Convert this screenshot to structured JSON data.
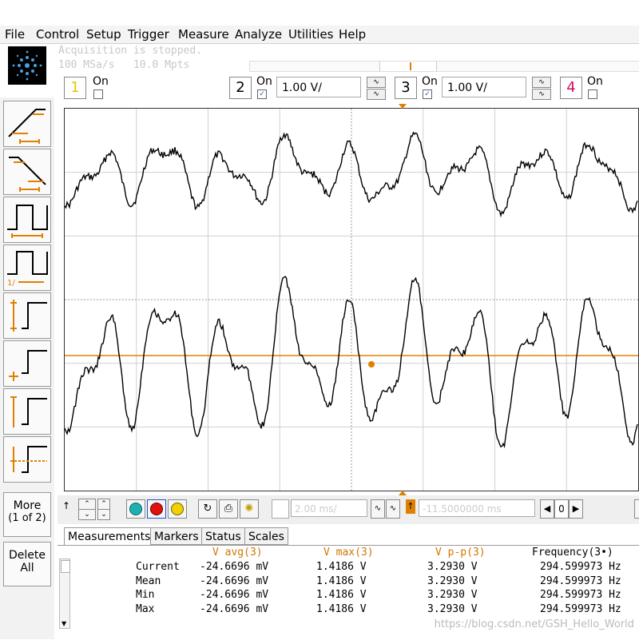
{
  "menu": [
    "File",
    "Control",
    "Setup",
    "Trigger",
    "Measure",
    "Analyze",
    "Utilities",
    "Help"
  ],
  "acquisition": {
    "status": "Acquisition is stopped.",
    "sample_rate": "100 MSa/s",
    "memory": "10.0 Mpts"
  },
  "channels": [
    {
      "num": "1",
      "on_label": "On",
      "checked": false,
      "color": "#e6c800"
    },
    {
      "num": "2",
      "on_label": "On",
      "checked": true,
      "scale": "1.00 V/",
      "color": "#000000"
    },
    {
      "num": "3",
      "on_label": "On",
      "checked": true,
      "scale": "1.00 V/",
      "color": "#000000"
    },
    {
      "num": "4",
      "on_label": "On",
      "checked": false,
      "color": "#d01060"
    }
  ],
  "left_panel": {
    "more": "More",
    "more_page": "(1 of 2)",
    "delete": "Delete",
    "delete_all": "All"
  },
  "bottom": {
    "horiz_scale": "2.00 ms/",
    "horiz_pos": "-11.5000000 ms",
    "zoom": "0"
  },
  "tabs": [
    "Measurements",
    "Markers",
    "Status",
    "Scales"
  ],
  "measurements": {
    "headers": [
      "V avg(3)",
      "V max(3)",
      "V p-p(3)",
      "Frequency(3•)"
    ],
    "rows": [
      {
        "label": "Current",
        "vavg": "-24.6696 mV",
        "vmax": "1.4186 V",
        "vpp": "3.2930 V",
        "freq": "294.599973 Hz"
      },
      {
        "label": "Mean",
        "vavg": "-24.6696 mV",
        "vmax": "1.4186 V",
        "vpp": "3.2930 V",
        "freq": "294.599973 Hz"
      },
      {
        "label": "Min",
        "vavg": "-24.6696 mV",
        "vmax": "1.4186 V",
        "vpp": "3.2930 V",
        "freq": "294.599973 Hz"
      },
      {
        "label": "Max",
        "vavg": "-24.6696 mV",
        "vmax": "1.4186 V",
        "vpp": "3.2930 V",
        "freq": "294.599973 Hz"
      }
    ]
  },
  "watermark": "https://blog.csdn.net/GSH_Hello_World",
  "colors": {
    "accent": "#e08000",
    "trace": "#000000",
    "grid": "#c8c8c8",
    "ch4": "#d01060",
    "ch1": "#e6c800"
  }
}
